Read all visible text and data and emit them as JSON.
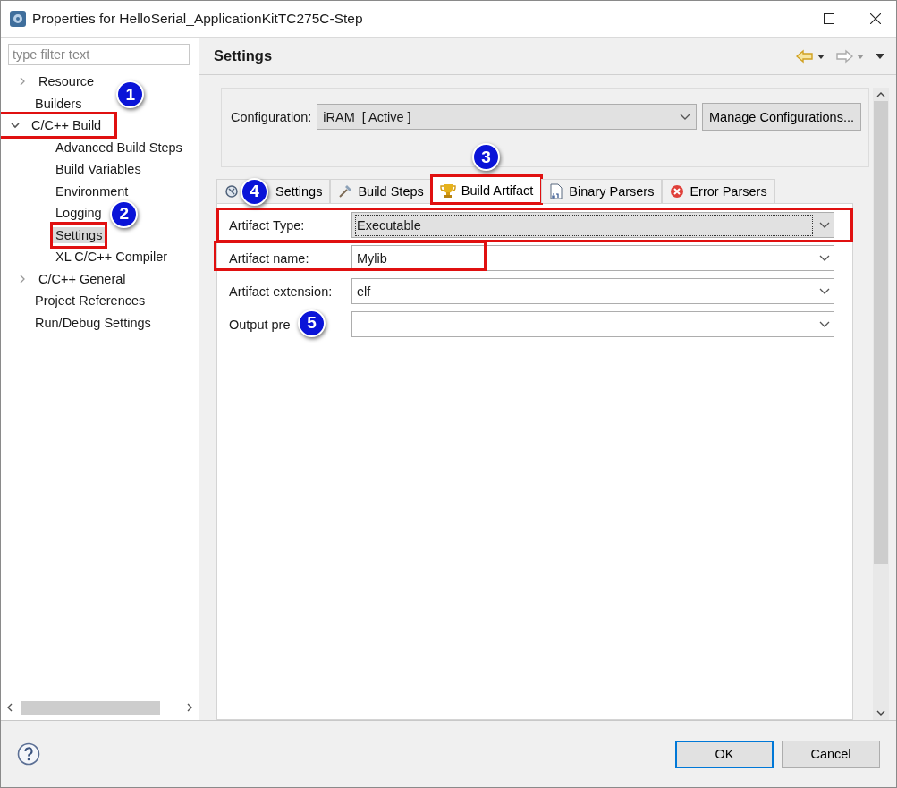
{
  "window": {
    "title": "Properties for HelloSerial_ApplicationKitTC275C-Step"
  },
  "filter": {
    "placeholder": "type filter text"
  },
  "tree": [
    {
      "label": "Resource",
      "expanded": false,
      "selected": false
    },
    {
      "label": "Builders",
      "selected": false
    },
    {
      "label": "C/C++ Build",
      "expanded": true,
      "selected": false,
      "highlighted": true,
      "callout": "1",
      "children": [
        {
          "label": "Advanced Build Steps",
          "selected": false
        },
        {
          "label": "Build Variables",
          "selected": false
        },
        {
          "label": "Environment",
          "selected": false
        },
        {
          "label": "Logging",
          "selected": false
        },
        {
          "label": "Settings",
          "selected": true,
          "highlighted": true,
          "callout": "2"
        },
        {
          "label": "XL C/C++ Compiler",
          "selected": false
        }
      ]
    },
    {
      "label": "C/C++ General",
      "expanded": false,
      "selected": false
    },
    {
      "label": "Project References",
      "selected": false
    },
    {
      "label": "Run/Debug Settings",
      "selected": false
    }
  ],
  "page": {
    "title": "Settings"
  },
  "configuration": {
    "label": "Configuration:",
    "value": "iRAM  [ Active ]",
    "button": "Manage Configurations..."
  },
  "tabs": [
    {
      "label": "Settings",
      "kind": "tools",
      "selected": false,
      "highlighted": false,
      "callout": "4"
    },
    {
      "label": "Build Steps",
      "kind": "steps",
      "selected": false,
      "highlighted": false
    },
    {
      "label": "Build Artifact",
      "kind": "artifact",
      "selected": true,
      "highlighted": true,
      "callout": "3"
    },
    {
      "label": "Binary Parsers",
      "kind": "binary",
      "selected": false,
      "highlighted": false
    },
    {
      "label": "Error Parsers",
      "kind": "error",
      "selected": false,
      "highlighted": false
    }
  ],
  "fields": [
    {
      "label": "Artifact Type:",
      "value": "Executable",
      "kind": "readonly",
      "highlighted": true
    },
    {
      "label": "Artifact name:",
      "value": "Mylib",
      "kind": "editable",
      "highlighted": true
    },
    {
      "label": "Artifact extension:",
      "value": "elf",
      "kind": "editable",
      "highlighted": false
    },
    {
      "label": "Output pre",
      "kind": "editable",
      "highlighted": false,
      "callout": "5"
    }
  ],
  "buttons": [
    {
      "label": "OK",
      "default": true
    },
    {
      "label": "Cancel",
      "default": false
    }
  ]
}
